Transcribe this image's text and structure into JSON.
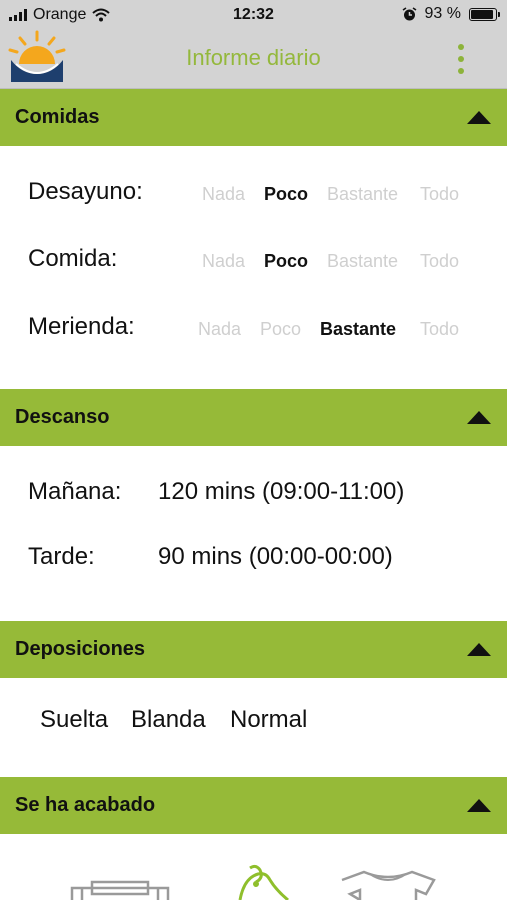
{
  "status_bar": {
    "carrier": "Orange",
    "time": "12:32",
    "battery_percent": "93 %",
    "battery_level": 0.93
  },
  "nav": {
    "title": "Informe diario",
    "logo_icon": "sunrise-logo-icon",
    "menu_icon": "more-vertical-icon"
  },
  "sections": {
    "meals": {
      "title": "Comidas",
      "rows": [
        {
          "label": "Desayuno:",
          "options": [
            "Nada",
            "Poco",
            "Bastante",
            "Todo"
          ],
          "selected": "Poco"
        },
        {
          "label": "Comida:",
          "options": [
            "Nada",
            "Poco",
            "Bastante",
            "Todo"
          ],
          "selected": "Poco"
        },
        {
          "label": "Merienda:",
          "options": [
            "Nada",
            "Poco",
            "Bastante",
            "Todo"
          ],
          "selected": "Bastante"
        }
      ]
    },
    "rest": {
      "title": "Descanso",
      "rows": [
        {
          "label": "Mañana:",
          "value": "120 mins (09:00-11:00)"
        },
        {
          "label": "Tarde:",
          "value": "90 mins (00:00-00:00)"
        }
      ]
    },
    "bowel": {
      "title": "Deposiciones",
      "items": [
        "Suelta",
        "Blanda",
        "Normal"
      ]
    },
    "finished": {
      "title": "Se ha acabado",
      "icons": [
        "crib-icon",
        "diaper-cream-icon",
        "bodysuit-icon"
      ]
    }
  },
  "colors": {
    "accent": "#96ba38",
    "title_green": "#94b83c",
    "bar_gray": "#d3d3d3",
    "muted": "#cfcfcf"
  }
}
